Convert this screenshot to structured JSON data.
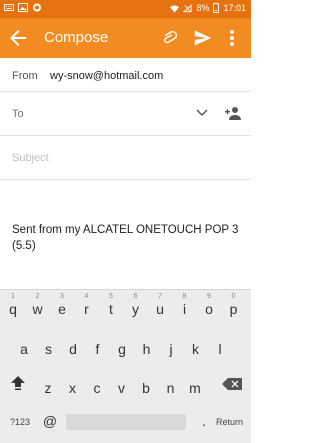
{
  "status_bar": {
    "battery": "8%",
    "time": "17:01"
  },
  "app_bar": {
    "title": "Compose"
  },
  "form": {
    "from_label": "From",
    "from_value": "wy-snow@hotmail.com",
    "to_label": "To",
    "subject_placeholder": "Subject",
    "body": "Sent from my ALCATEL ONETOUCH POP 3 (5.5)"
  },
  "keyboard": {
    "row1": [
      {
        "ch": "q",
        "hint": "1"
      },
      {
        "ch": "w",
        "hint": "2"
      },
      {
        "ch": "e",
        "hint": "3"
      },
      {
        "ch": "r",
        "hint": "4"
      },
      {
        "ch": "t",
        "hint": "5"
      },
      {
        "ch": "y",
        "hint": "6"
      },
      {
        "ch": "u",
        "hint": "7"
      },
      {
        "ch": "i",
        "hint": "8"
      },
      {
        "ch": "o",
        "hint": "9"
      },
      {
        "ch": "p",
        "hint": "0"
      }
    ],
    "row2": [
      "a",
      "s",
      "d",
      "f",
      "g",
      "h",
      "j",
      "k",
      "l"
    ],
    "row3": [
      "z",
      "x",
      "c",
      "v",
      "b",
      "n",
      "m"
    ],
    "symbols_label": "?123",
    "at_label": "@",
    "period_label": ".",
    "return_label": "Return"
  },
  "colors": {
    "app_bar": "#f28b22",
    "status_bar": "#e5720f"
  },
  "icons": [
    "back-arrow-icon",
    "attach-icon",
    "send-icon",
    "overflow-menu-icon",
    "chevron-down-icon",
    "add-person-icon",
    "shift-icon",
    "backspace-icon"
  ]
}
